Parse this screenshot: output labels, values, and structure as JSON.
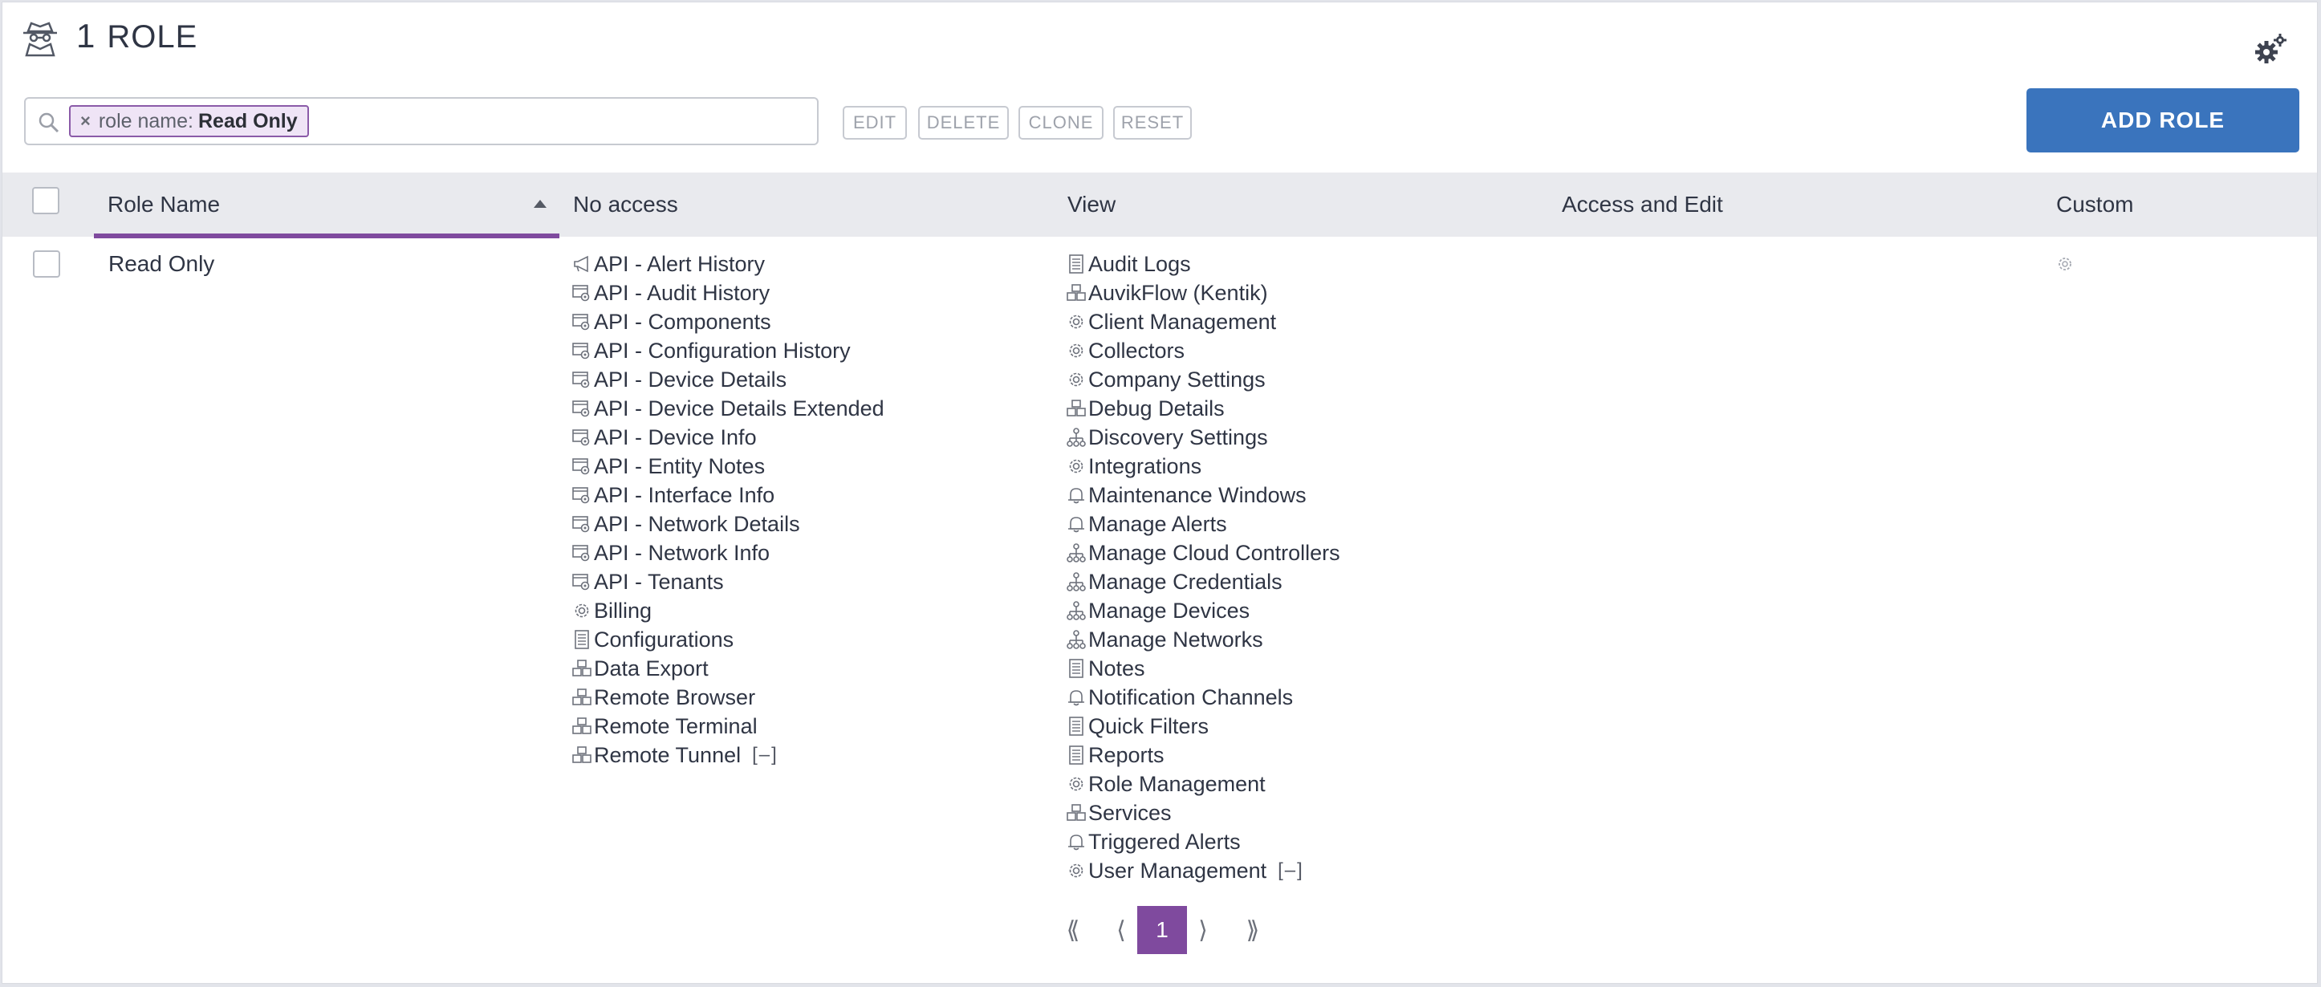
{
  "header": {
    "count": "1",
    "title": "ROLE",
    "icon": "role-spy-icon",
    "settings_icon": "gears-icon"
  },
  "search": {
    "icon": "search-icon",
    "filter_chip": {
      "remove": "×",
      "key": "role name:",
      "value": "Read Only"
    }
  },
  "toolbar": {
    "edit": "EDIT",
    "delete": "DELETE",
    "clone": "CLONE",
    "reset": "RESET",
    "add_role": "ADD ROLE"
  },
  "table": {
    "columns": {
      "role_name": "Role Name",
      "no_access": "No access",
      "view": "View",
      "access_edit": "Access and Edit",
      "custom": "Custom"
    },
    "sort": {
      "column": "role_name",
      "direction": "ascending"
    },
    "rows": [
      {
        "role_name": "Read Only",
        "no_access": [
          {
            "icon": "megaphone-icon",
            "label": "API - Alert History"
          },
          {
            "icon": "api-window-icon",
            "label": "API - Audit History"
          },
          {
            "icon": "api-window-icon",
            "label": "API - Components"
          },
          {
            "icon": "api-window-icon",
            "label": "API - Configuration History"
          },
          {
            "icon": "api-window-icon",
            "label": "API - Device Details"
          },
          {
            "icon": "api-window-icon",
            "label": "API - Device Details Extended"
          },
          {
            "icon": "api-window-icon",
            "label": "API - Device Info"
          },
          {
            "icon": "api-window-icon",
            "label": "API - Entity Notes"
          },
          {
            "icon": "api-window-icon",
            "label": "API - Interface Info"
          },
          {
            "icon": "api-window-icon",
            "label": "API - Network Details"
          },
          {
            "icon": "api-window-icon",
            "label": "API - Network Info"
          },
          {
            "icon": "api-window-icon",
            "label": "API - Tenants"
          },
          {
            "icon": "gear-icon",
            "label": "Billing"
          },
          {
            "icon": "document-icon",
            "label": "Configurations"
          },
          {
            "icon": "boxes-icon",
            "label": "Data Export"
          },
          {
            "icon": "boxes-icon",
            "label": "Remote Browser"
          },
          {
            "icon": "boxes-icon",
            "label": "Remote Terminal"
          },
          {
            "icon": "boxes-icon",
            "label": "Remote Tunnel"
          }
        ],
        "view": [
          {
            "icon": "document-icon",
            "label": "Audit Logs"
          },
          {
            "icon": "boxes-icon",
            "label": "AuvikFlow (Kentik)"
          },
          {
            "icon": "gear-icon",
            "label": "Client Management"
          },
          {
            "icon": "gear-icon",
            "label": "Collectors"
          },
          {
            "icon": "gear-icon",
            "label": "Company Settings"
          },
          {
            "icon": "boxes-icon",
            "label": "Debug Details"
          },
          {
            "icon": "network-icon",
            "label": "Discovery Settings"
          },
          {
            "icon": "gear-icon",
            "label": "Integrations"
          },
          {
            "icon": "bell-icon",
            "label": "Maintenance Windows"
          },
          {
            "icon": "bell-icon",
            "label": "Manage Alerts"
          },
          {
            "icon": "network-icon",
            "label": "Manage Cloud Controllers"
          },
          {
            "icon": "network-icon",
            "label": "Manage Credentials"
          },
          {
            "icon": "network-icon",
            "label": "Manage Devices"
          },
          {
            "icon": "network-icon",
            "label": "Manage Networks"
          },
          {
            "icon": "document-icon",
            "label": "Notes"
          },
          {
            "icon": "bell-icon",
            "label": "Notification Channels"
          },
          {
            "icon": "document-icon",
            "label": "Quick Filters"
          },
          {
            "icon": "document-icon",
            "label": "Reports"
          },
          {
            "icon": "gear-icon",
            "label": "Role Management"
          },
          {
            "icon": "boxes-icon",
            "label": "Services"
          },
          {
            "icon": "bell-icon",
            "label": "Triggered Alerts"
          },
          {
            "icon": "gear-icon",
            "label": "User Management"
          }
        ],
        "collapse_label": "[–]",
        "custom_icon": "custom-gear-icon"
      }
    ]
  },
  "pagination": {
    "first": "⟪",
    "prev": "⟨",
    "current": "1",
    "next": "⟩",
    "last": "⟫"
  },
  "colors": {
    "accent": "#7f4a9e",
    "primary_button": "#3a74bd",
    "chip_bg": "#efe4f6",
    "header_bg": "#e9eaee"
  }
}
